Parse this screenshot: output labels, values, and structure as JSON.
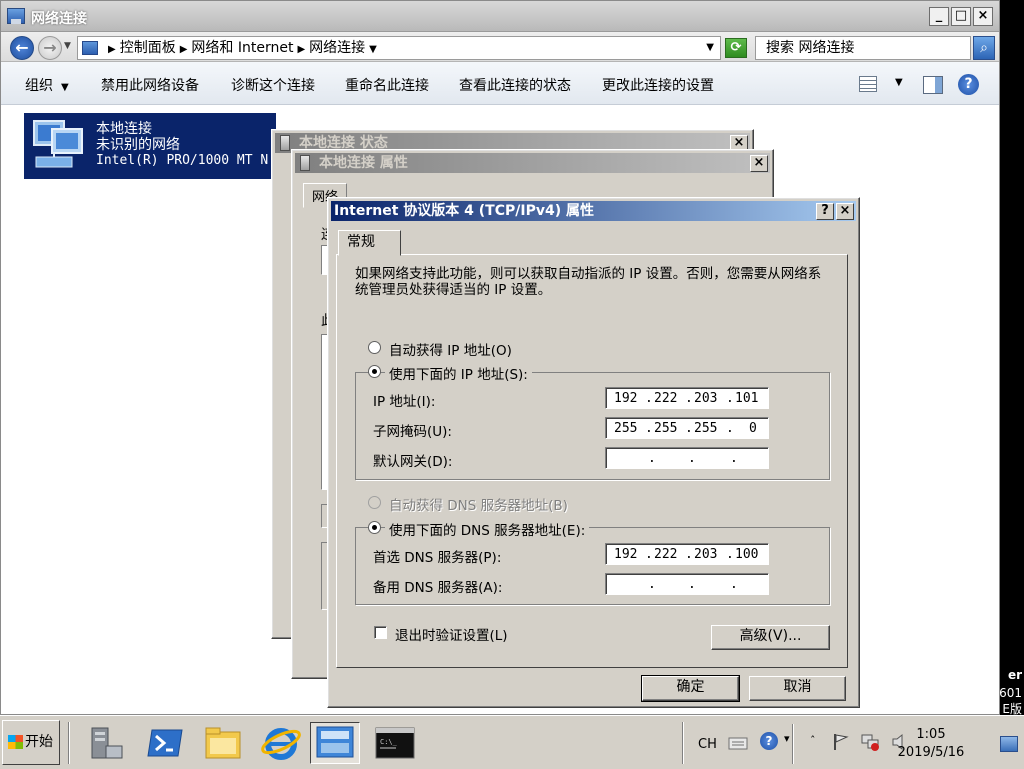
{
  "explorer": {
    "title": "网络连接",
    "address": {
      "crumbs": [
        "控制面板",
        "网络和 Internet",
        "网络连接"
      ],
      "search_placeholder": "搜索 网络连接"
    },
    "toolbar": {
      "organize": "组织",
      "disable": "禁用此网络设备",
      "diagnose": "诊断这个连接",
      "rename": "重命名此连接",
      "view_status": "查看此连接的状态",
      "change_settings": "更改此连接的设置"
    },
    "connection": {
      "name": "本地连接",
      "status": "未识别的网络",
      "adapter": "Intel(R) PRO/1000 MT N"
    }
  },
  "status_dialog": {
    "title": "本地连接 状态"
  },
  "props_dialog": {
    "title": "本地连接 属性",
    "tab": "网络",
    "frag_chars": [
      "连",
      "此"
    ]
  },
  "ipv4_dialog": {
    "title": "Internet 协议版本 4 (TCP/IPv4) 属性",
    "tab": "常规",
    "description": "如果网络支持此功能，则可以获取自动指派的 IP 设置。否则，您需要从网络系统管理员处获得适当的 IP 设置。",
    "auto_ip_label": "自动获得 IP 地址(O)",
    "manual_ip_label": "使用下面的 IP 地址(S):",
    "ip_label": "IP 地址(I):",
    "ip_octets": [
      "192",
      "222",
      "203",
      "101"
    ],
    "mask_label": "子网掩码(U):",
    "mask_octets": [
      "255",
      "255",
      "255",
      "0"
    ],
    "gateway_label": "默认网关(D):",
    "gateway_octets": [
      "",
      "",
      "",
      ""
    ],
    "auto_dns_label": "自动获得 DNS 服务器地址(B)",
    "manual_dns_label": "使用下面的 DNS 服务器地址(E):",
    "preferred_dns_label": "首选 DNS 服务器(P):",
    "preferred_dns_octets": [
      "192",
      "222",
      "203",
      "100"
    ],
    "alternate_dns_label": "备用 DNS 服务器(A):",
    "alternate_dns_octets": [
      "",
      "",
      "",
      ""
    ],
    "validate_label": "退出时验证设置(L)",
    "advanced_button": "高级(V)...",
    "ok_button": "确定",
    "cancel_button": "取消",
    "help_glyph": "?",
    "close_glyph": "×"
  },
  "desktop_fragments": [
    "er",
    "601",
    "E版"
  ],
  "taskbar": {
    "start": "开始",
    "lang": "CH",
    "time": "1:05",
    "date": "2019/5/16"
  },
  "icons": [
    "search-icon",
    "back-arrow-icon",
    "forward-arrow-icon",
    "refresh-icon",
    "help-icon",
    "network-adapter-icon",
    "windows-logo-icon"
  ]
}
